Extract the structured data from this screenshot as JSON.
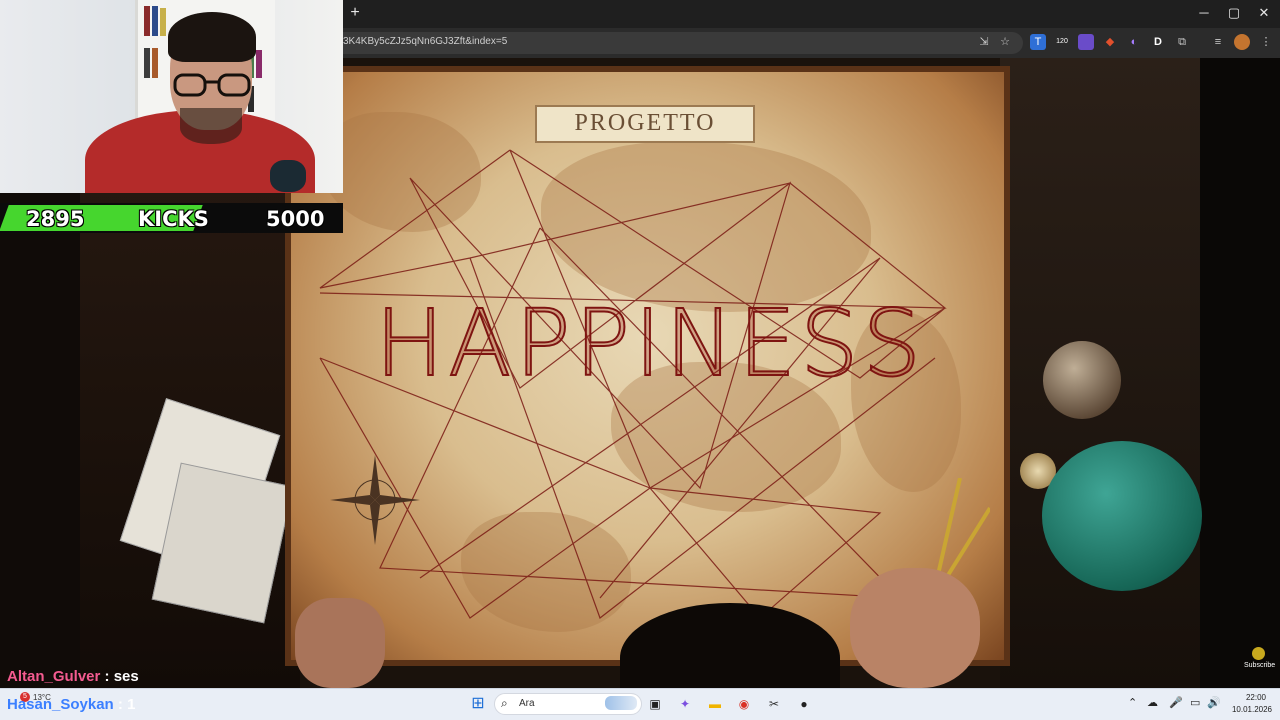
{
  "browser": {
    "url": "3K4KBy5cZJz5qNn6GJ3Zft&index=5",
    "new_tab_label": "+",
    "window_controls": [
      "─",
      "▢",
      "✕"
    ],
    "extension_badge": "120"
  },
  "video": {
    "banner_text": "PROGETTO",
    "title_text": "HAPPINESS"
  },
  "kicks": {
    "current": "2895",
    "label": "KICKS",
    "goal": "5000",
    "progress_fraction": 0.579
  },
  "chat": [
    {
      "user": "Altan_Gulver",
      "message": " : ses"
    },
    {
      "user": "Hasan_Soykan",
      "message": " : 1"
    }
  ],
  "subscribe_label": "Subscribe",
  "taskbar": {
    "weather_temp": "13°C",
    "weather_badge": "5",
    "search_placeholder": "Ara",
    "time": "22:00",
    "date": "10.01.2026"
  },
  "colors": {
    "kick_green": "#46d62e",
    "chat_user1": "#f45b90",
    "chat_user2": "#3b7fff",
    "title_red": "#7e1411"
  }
}
